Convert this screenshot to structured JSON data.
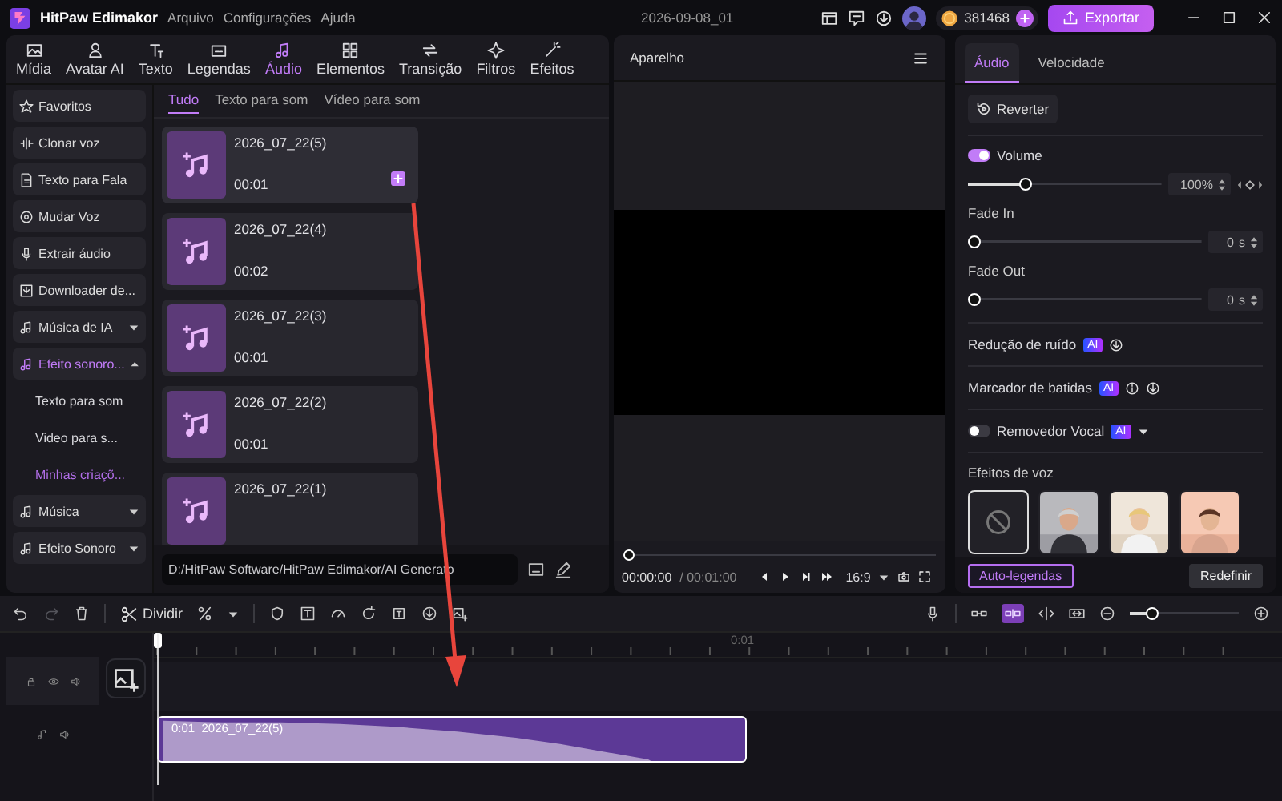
{
  "title_bar": {
    "app_name": "HitPaw Edimakor",
    "menu": [
      "Arquivo",
      "Configurações",
      "Ajuda"
    ],
    "project_name": "2026-09-08_01",
    "credits": "381468",
    "export_button": "Exportar"
  },
  "media_tabs": [
    {
      "label": "Mídia",
      "selected": false
    },
    {
      "label": "Avatar AI",
      "selected": false
    },
    {
      "label": "Texto",
      "selected": false
    },
    {
      "label": "Legendas",
      "selected": false
    },
    {
      "label": "Áudio",
      "selected": true
    },
    {
      "label": "Elementos",
      "selected": false
    },
    {
      "label": "Transição",
      "selected": false
    },
    {
      "label": "Filtros",
      "selected": false
    },
    {
      "label": "Efeitos",
      "selected": false
    }
  ],
  "sidebar": {
    "items": [
      {
        "label": "Favoritos",
        "kind": "item",
        "selected": false
      },
      {
        "label": "Clonar voz",
        "kind": "item",
        "selected": false
      },
      {
        "label": "Texto para Fala",
        "kind": "item",
        "selected": false
      },
      {
        "label": "Mudar Voz",
        "kind": "item",
        "selected": false
      },
      {
        "label": "Extrair áudio",
        "kind": "item",
        "selected": false
      },
      {
        "label": "Downloader de...",
        "kind": "item",
        "selected": false
      },
      {
        "label": "Música de IA",
        "kind": "group",
        "selected": false,
        "expanded": false
      },
      {
        "label": "Efeito sonoro...",
        "kind": "group",
        "selected": true,
        "expanded": true,
        "children": [
          {
            "label": "Texto para som",
            "selected": false
          },
          {
            "label": "Video para s...",
            "selected": false
          },
          {
            "label": "Minhas criaçõ...",
            "selected": true
          }
        ]
      },
      {
        "label": "Música",
        "kind": "group",
        "selected": false,
        "expanded": false
      },
      {
        "label": "Efeito Sonoro",
        "kind": "group",
        "selected": false,
        "expanded": false
      }
    ]
  },
  "library": {
    "tabs": [
      {
        "label": "Tudo",
        "selected": true
      },
      {
        "label": "Texto para som",
        "selected": false
      },
      {
        "label": "Vídeo para som",
        "selected": false
      }
    ],
    "cards": [
      {
        "title": "2026_07_22(5)",
        "duration": "00:01",
        "hovered": true
      },
      {
        "title": "2026_07_22(4)",
        "duration": "00:02",
        "hovered": false
      },
      {
        "title": "2026_07_22(3)",
        "duration": "00:01",
        "hovered": false
      },
      {
        "title": "2026_07_22(2)",
        "duration": "00:01",
        "hovered": false
      },
      {
        "title": "2026_07_22(1)",
        "hovered": false
      }
    ],
    "path": "D:/HitPaw Software/HitPaw Edimakor/AI Generato"
  },
  "preview": {
    "title": "Aparelho",
    "progress": {
      "level": 0
    },
    "current_time": "00:00:00",
    "total_time": "/ 00:01:00",
    "aspect_ratio": "16:9"
  },
  "properties": {
    "tabs": [
      {
        "label": "Áudio",
        "selected": true
      },
      {
        "label": "Velocidade",
        "selected": false
      }
    ],
    "revert_button": "Reverter",
    "volume": {
      "label": "Volume",
      "on": true,
      "level": 0.28,
      "value": "100%"
    },
    "fade_in": {
      "label": "Fade In",
      "level": 0,
      "value": "0",
      "unit": "s"
    },
    "fade_out": {
      "label": "Fade Out",
      "level": 0,
      "value": "0",
      "unit": "s"
    },
    "features": [
      {
        "label": "Redução de ruído",
        "badge": "AI",
        "kind": "download"
      },
      {
        "label": "Marcador de batidas",
        "badge": "AI",
        "kind": "info_download"
      },
      {
        "label": "Removedor Vocal",
        "badge": "AI",
        "kind": "toggle",
        "on": false
      }
    ],
    "voice_effects": {
      "title": "Efeitos de voz",
      "items": [
        {
          "kind": "none",
          "selected": true
        },
        {
          "kind": "picture",
          "selected": false
        },
        {
          "kind": "picture",
          "selected": false
        },
        {
          "kind": "picture",
          "selected": false
        }
      ]
    },
    "auto_captions_button": "Auto-legendas",
    "reset_button": "Redefinir"
  },
  "toolbar": {
    "split_button": "Dividir",
    "snap_on": true,
    "zoom": {
      "level": 0.17
    }
  },
  "timeline": {
    "ruler_label": "0:01",
    "clip": {
      "time": "0:01",
      "name": "2026_07_22(5)",
      "selected": true
    }
  }
}
